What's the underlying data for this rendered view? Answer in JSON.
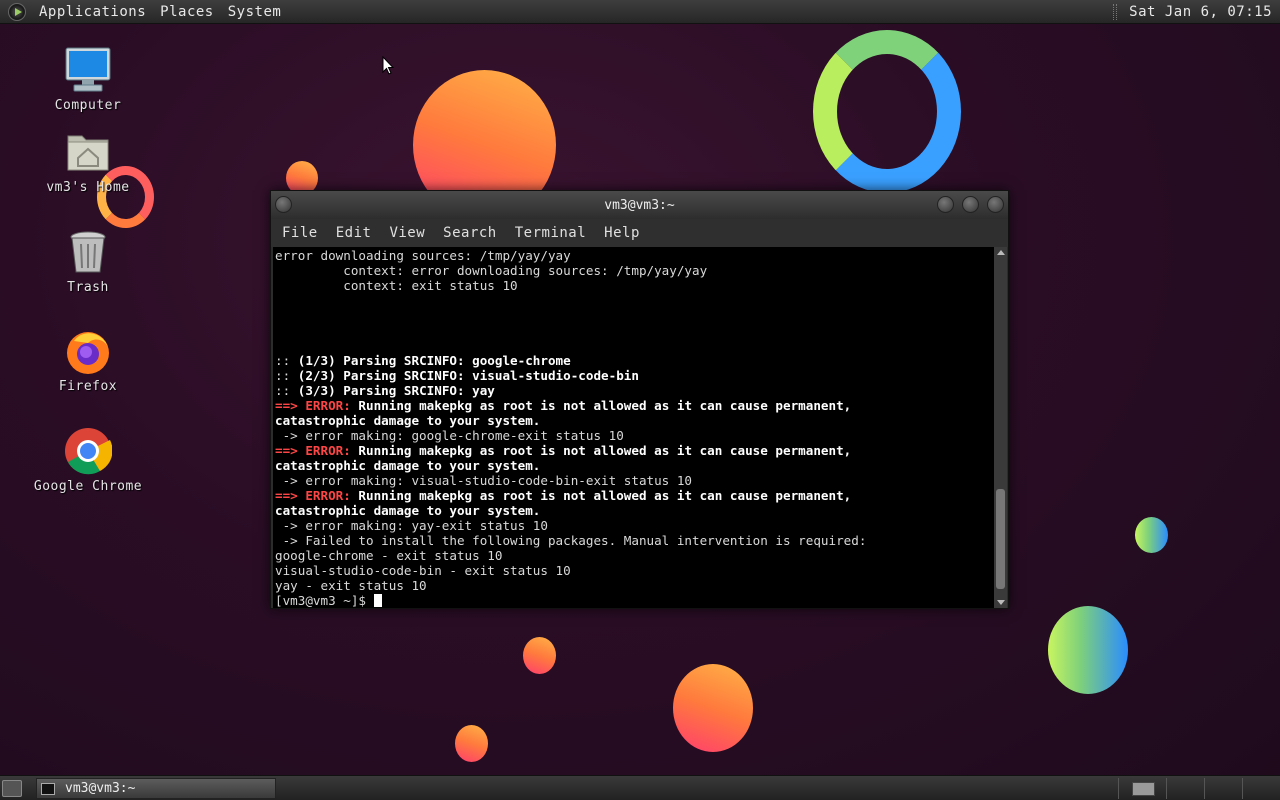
{
  "top_panel": {
    "menus": [
      "Applications",
      "Places",
      "System"
    ],
    "clock": "Sat Jan  6, 07:15"
  },
  "desktop_icons": [
    {
      "label": "Computer"
    },
    {
      "label": "vm3's Home"
    },
    {
      "label": "Trash"
    },
    {
      "label": "Firefox"
    },
    {
      "label": "Google Chrome"
    }
  ],
  "terminal": {
    "title": "vm3@vm3:~",
    "menu": [
      "File",
      "Edit",
      "View",
      "Search",
      "Terminal",
      "Help"
    ],
    "lines": [
      "error downloading sources: /tmp/yay/yay",
      "         context: error downloading sources: /tmp/yay/yay",
      "         context: exit status 10",
      "",
      "",
      "",
      "",
      ":: (1/3) Parsing SRCINFO: google-chrome",
      ":: (2/3) Parsing SRCINFO: visual-studio-code-bin",
      ":: (3/3) Parsing SRCINFO: yay",
      "==> ERROR: Running makepkg as root is not allowed as it can cause permanent,",
      "catastrophic damage to your system.",
      " -> error making: google-chrome-exit status 10",
      "==> ERROR: Running makepkg as root is not allowed as it can cause permanent,",
      "catastrophic damage to your system.",
      " -> error making: visual-studio-code-bin-exit status 10",
      "==> ERROR: Running makepkg as root is not allowed as it can cause permanent,",
      "catastrophic damage to your system.",
      " -> error making: yay-exit status 10",
      " -> Failed to install the following packages. Manual intervention is required:",
      "google-chrome - exit status 10",
      "visual-studio-code-bin - exit status 10",
      "yay - exit status 10",
      "[vm3@vm3 ~]$ "
    ]
  },
  "taskbar": {
    "task_title": "vm3@vm3:~"
  }
}
